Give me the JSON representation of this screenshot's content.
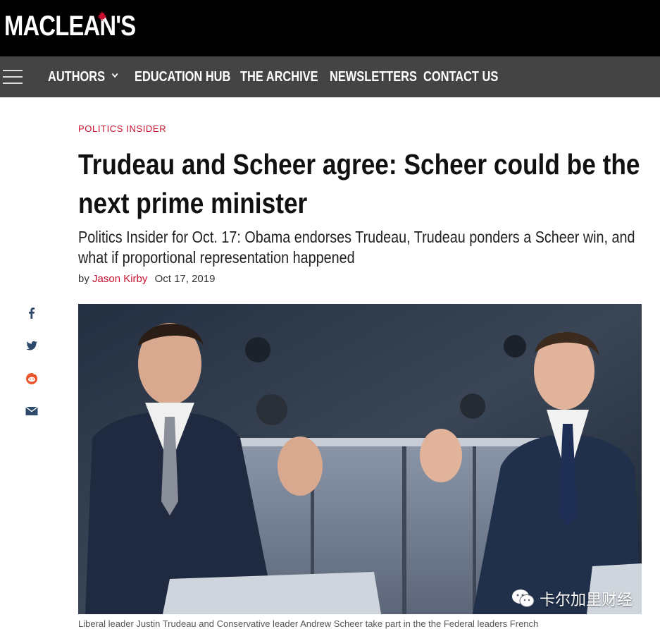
{
  "site": {
    "logo_text": "MACLEAN'S",
    "brand_color": "#c8102e"
  },
  "nav": {
    "menu_icon": "hamburger-icon",
    "items": [
      {
        "label": "AUTHORS",
        "has_dropdown": true
      },
      {
        "label": "EDUCATION HUB"
      },
      {
        "label": "THE ARCHIVE"
      },
      {
        "label": "NEWSLETTERS"
      },
      {
        "label": "CONTACT US"
      }
    ]
  },
  "article": {
    "kicker": "POLITICS INSIDER",
    "headline": "Trudeau and Scheer agree: Scheer could be the next prime minister",
    "dek": "Politics Insider for Oct. 17: Obama endorses Trudeau, Trudeau ponders a Scheer win, and what if proportional representation happened",
    "byline_prefix": "by",
    "author": "Jason Kirby",
    "date": "Oct 17, 2019",
    "caption": "Liberal leader Justin Trudeau and Conservative leader Andrew Scheer take part in the the Federal leaders French"
  },
  "share": [
    {
      "icon": "facebook-icon"
    },
    {
      "icon": "twitter-icon"
    },
    {
      "icon": "reddit-icon"
    },
    {
      "icon": "email-icon"
    }
  ],
  "watermark": {
    "icon": "wechat-icon",
    "text": "卡尔加里财经"
  },
  "colors": {
    "topbar": "#000000",
    "navbar": "#444444",
    "share_icons": "#2e4a6b"
  }
}
